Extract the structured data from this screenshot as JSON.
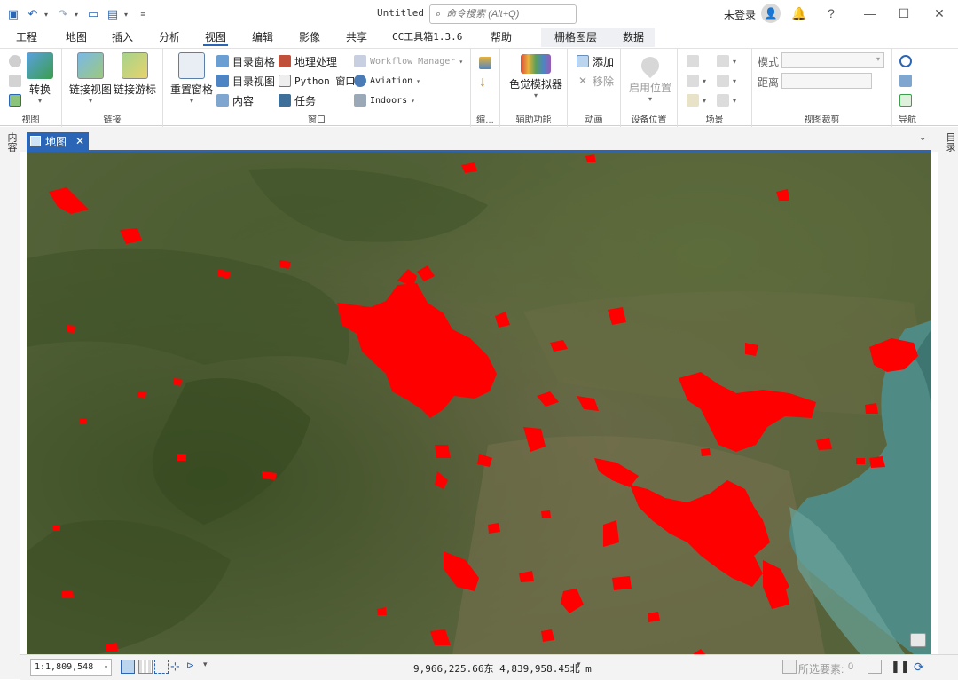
{
  "window": {
    "title": "Untitled",
    "search_placeholder": "命令搜索 (Alt+Q)",
    "signin_label": "未登录"
  },
  "tabs": [
    {
      "label": "工程"
    },
    {
      "label": "地图"
    },
    {
      "label": "插入"
    },
    {
      "label": "分析"
    },
    {
      "label": "视图",
      "active": true
    },
    {
      "label": "编辑"
    },
    {
      "label": "影像"
    },
    {
      "label": "共享"
    },
    {
      "label": "CC工具箱1.3.6"
    },
    {
      "label": "帮助"
    },
    {
      "label": "栅格图层",
      "contextual": true
    },
    {
      "label": "数据",
      "contextual": true
    }
  ],
  "ribbon": {
    "view_group": {
      "label": "视图",
      "convert_label": "转换"
    },
    "link_group": {
      "label": "链接",
      "link_views": "链接视图",
      "link_cursors": "链接游标"
    },
    "window_group": {
      "label": "窗口",
      "reset_panes": "重置窗格",
      "catalog_pane": "目录窗格",
      "catalog_view": "目录视图",
      "contents": "内容",
      "geoprocessing": "地理处理",
      "python_window": "Python 窗口",
      "tasks": "任务",
      "workflow_manager": "Workflow Manager",
      "aviation": "Aviation",
      "indoors": "Indoors"
    },
    "color_group": {
      "label": "缩…"
    },
    "accessibility_group": {
      "label": "辅助功能",
      "color_simulator": "色觉模拟器"
    },
    "animation_group": {
      "label": "动画",
      "add": "添加",
      "remove": "移除"
    },
    "device_group": {
      "label": "设备位置",
      "enable_location": "启用位置"
    },
    "scene_group": {
      "label": "场景"
    },
    "clip_group": {
      "label": "视图裁剪",
      "mode_label": "模式",
      "distance_label": "距离"
    },
    "nav_group": {
      "label": "导航"
    }
  },
  "side_panels": {
    "left": "内容",
    "right": "目录"
  },
  "document_tab": {
    "label": "地图"
  },
  "status_bar": {
    "scale": "1:1,809,548",
    "coordinates": "9,966,225.66东 4,839,958.45北 m",
    "selected_label": "所选要素:",
    "selected_count": "0"
  },
  "colors": {
    "accent": "#2a66b5",
    "urban_mask": "#ff0000",
    "water": "#4f8a84"
  }
}
